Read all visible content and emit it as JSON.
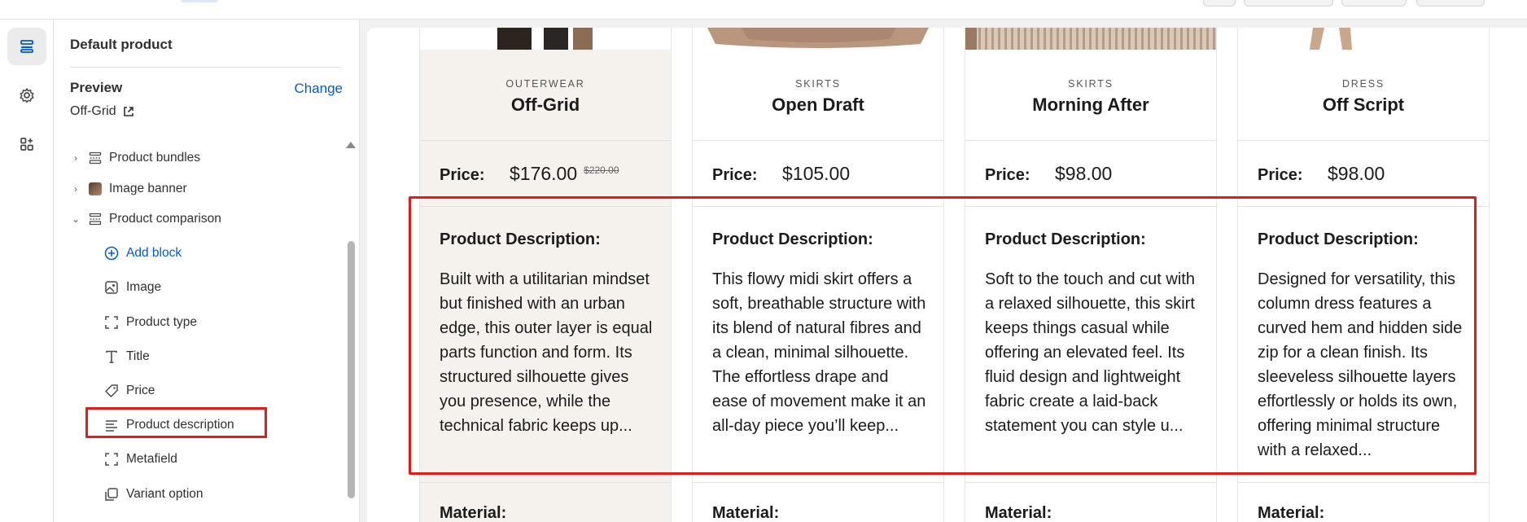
{
  "colors": {
    "accent": "#005bd3",
    "highlight": "#e21b1b",
    "first_column_bg": "#f5f2ee"
  },
  "rail": {
    "items": [
      {
        "name": "sections",
        "icon": "sections-icon",
        "active": true
      },
      {
        "name": "settings",
        "icon": "gear-icon",
        "active": false
      },
      {
        "name": "apps",
        "icon": "apps-icon",
        "active": false
      }
    ]
  },
  "panel": {
    "title": "Default product",
    "preview": {
      "label": "Preview",
      "change_label": "Change",
      "value": "Off-Grid"
    },
    "tree": [
      {
        "label": "Product bundles",
        "icon": "section-icon",
        "chevron": "right"
      },
      {
        "label": "Image banner",
        "icon": "image-thumbnail-icon",
        "chevron": "right"
      },
      {
        "label": "Product comparison",
        "icon": "section-icon",
        "chevron": "down"
      },
      {
        "label": "Add block",
        "icon": "plus-circle-icon"
      },
      {
        "label": "Image",
        "icon": "image-icon"
      },
      {
        "label": "Product type",
        "icon": "product-type-icon"
      },
      {
        "label": "Title",
        "icon": "text-icon"
      },
      {
        "label": "Price",
        "icon": "price-tag-icon"
      },
      {
        "label": "Product description",
        "icon": "text-align-left-icon",
        "highlighted": true
      },
      {
        "label": "Metafield",
        "icon": "metafield-icon"
      },
      {
        "label": "Variant option",
        "icon": "variant-icon"
      }
    ]
  },
  "products": [
    {
      "type": "OUTERWEAR",
      "title": "Off-Grid",
      "price_label": "Price:",
      "price": "$176.00",
      "compare_price": "$220.00",
      "description_label": "Product Description:",
      "description": "Built with a utilitarian mindset but finished with an urban edge, this outer layer is equal parts function and form. Its structured silhouette gives you presence, while the technical fabric keeps up...",
      "material_label": "Material:"
    },
    {
      "type": "SKIRTS",
      "title": "Open Draft",
      "price_label": "Price:",
      "price": "$105.00",
      "compare_price": "",
      "description_label": "Product Description:",
      "description": "This flowy midi skirt offers a soft, breathable structure with its blend of natural fibres and a clean, minimal silhouette. The effortless drape and ease of movement make it an all-day piece you’ll keep...",
      "material_label": "Material:"
    },
    {
      "type": "SKIRTS",
      "title": "Morning After",
      "price_label": "Price:",
      "price": "$98.00",
      "compare_price": "",
      "description_label": "Product Description:",
      "description": "Soft to the touch and cut with a relaxed silhouette, this skirt keeps things casual while offering an elevated feel. Its fluid design and lightweight fabric create a laid-back statement you can style u...",
      "material_label": "Material:"
    },
    {
      "type": "DRESS",
      "title": "Off Script",
      "price_label": "Price:",
      "price": "$98.00",
      "compare_price": "",
      "description_label": "Product Description:",
      "description": "Designed for versatility, this column dress features a curved hem and hidden side zip for a clean finish. Its sleeveless silhouette layers effortlessly or holds its own, offering minimal structure with a relaxed...",
      "material_label": "Material:"
    }
  ]
}
